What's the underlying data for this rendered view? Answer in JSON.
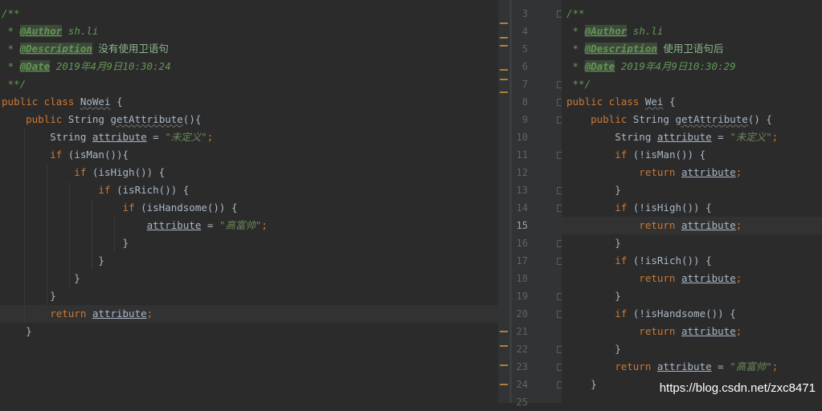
{
  "left": {
    "lines": [
      {
        "parts": [
          {
            "t": "/**",
            "c": "cm"
          }
        ]
      },
      {
        "parts": [
          {
            "t": " * ",
            "c": "cm"
          },
          {
            "t": "@Author",
            "c": "tag"
          },
          {
            "t": " sh.li",
            "c": "cm"
          }
        ]
      },
      {
        "parts": [
          {
            "t": " * ",
            "c": "cm"
          },
          {
            "t": "@Description",
            "c": "tag"
          },
          {
            "t": " 没有使用卫语句",
            "c": "cmt-zh"
          }
        ]
      },
      {
        "parts": [
          {
            "t": " * ",
            "c": "cm"
          },
          {
            "t": "@Date",
            "c": "tag"
          },
          {
            "t": " 2019年4月9日10:30:24",
            "c": "cm"
          }
        ]
      },
      {
        "parts": [
          {
            "t": " **/",
            "c": "cm"
          }
        ]
      },
      {
        "parts": [
          {
            "t": "public class ",
            "c": "kw"
          },
          {
            "t": "NoWei",
            "c": "fn"
          },
          {
            "t": " {",
            "c": ""
          }
        ]
      },
      {
        "parts": [
          {
            "t": "    public ",
            "c": "kw"
          },
          {
            "t": "String ",
            "c": ""
          },
          {
            "t": "getAttribute",
            "c": "fn"
          },
          {
            "t": "(){",
            "c": ""
          }
        ]
      },
      {
        "parts": [
          {
            "t": "        String ",
            "c": ""
          },
          {
            "t": "attribute",
            "c": "fld"
          },
          {
            "t": " = ",
            "c": ""
          },
          {
            "t": "\"未定义\"",
            "c": "str"
          },
          {
            "t": ";",
            "c": "kw"
          }
        ]
      },
      {
        "parts": [
          {
            "t": "        if ",
            "c": "kw"
          },
          {
            "t": "(isMan()){",
            "c": ""
          }
        ]
      },
      {
        "parts": [
          {
            "t": "            if ",
            "c": "kw"
          },
          {
            "t": "(isHigh()) {",
            "c": ""
          }
        ]
      },
      {
        "parts": [
          {
            "t": "                if ",
            "c": "kw"
          },
          {
            "t": "(isRich()) {",
            "c": ""
          }
        ]
      },
      {
        "parts": [
          {
            "t": "                    if ",
            "c": "kw"
          },
          {
            "t": "(isHandsome()) {",
            "c": ""
          }
        ]
      },
      {
        "parts": [
          {
            "t": "                        ",
            "c": ""
          },
          {
            "t": "attribute",
            "c": "fld"
          },
          {
            "t": " = ",
            "c": ""
          },
          {
            "t": "\"高富帅\"",
            "c": "str"
          },
          {
            "t": ";",
            "c": "kw"
          }
        ]
      },
      {
        "parts": [
          {
            "t": "                    }",
            "c": ""
          }
        ]
      },
      {
        "parts": [
          {
            "t": "                }",
            "c": ""
          }
        ]
      },
      {
        "parts": [
          {
            "t": "            }",
            "c": ""
          }
        ]
      },
      {
        "parts": [
          {
            "t": "        }",
            "c": ""
          }
        ]
      },
      {
        "hl": true,
        "parts": [
          {
            "t": "        return ",
            "c": "kw"
          },
          {
            "t": "attribute",
            "c": "fld"
          },
          {
            "t": ";",
            "c": "kw"
          }
        ]
      },
      {
        "parts": [
          {
            "t": "    }",
            "c": ""
          }
        ]
      }
    ]
  },
  "right": {
    "current_line": "15",
    "lines": [
      {
        "n": "3",
        "parts": [
          {
            "t": "/**",
            "c": "cm"
          }
        ]
      },
      {
        "n": "4",
        "parts": [
          {
            "t": " * ",
            "c": "cm"
          },
          {
            "t": "@Author",
            "c": "tag"
          },
          {
            "t": " sh.li",
            "c": "cm"
          }
        ]
      },
      {
        "n": "5",
        "parts": [
          {
            "t": " * ",
            "c": "cm"
          },
          {
            "t": "@Description",
            "c": "tag"
          },
          {
            "t": " 使用卫语句后",
            "c": "cmt-zh"
          }
        ]
      },
      {
        "n": "6",
        "parts": [
          {
            "t": " * ",
            "c": "cm"
          },
          {
            "t": "@Date",
            "c": "tag"
          },
          {
            "t": " 2019年4月9日10:30:29",
            "c": "cm"
          }
        ]
      },
      {
        "n": "7",
        "parts": [
          {
            "t": " **/",
            "c": "cm"
          }
        ]
      },
      {
        "n": "8",
        "parts": [
          {
            "t": "public class ",
            "c": "kw"
          },
          {
            "t": "Wei",
            "c": "fn"
          },
          {
            "t": " {",
            "c": ""
          }
        ]
      },
      {
        "n": "9",
        "parts": [
          {
            "t": "    public ",
            "c": "kw"
          },
          {
            "t": "String ",
            "c": ""
          },
          {
            "t": "getAttribute",
            "c": "fn"
          },
          {
            "t": "() {",
            "c": ""
          }
        ]
      },
      {
        "n": "10",
        "parts": [
          {
            "t": "        String ",
            "c": ""
          },
          {
            "t": "attribute",
            "c": "fld"
          },
          {
            "t": " = ",
            "c": ""
          },
          {
            "t": "\"未定义\"",
            "c": "str"
          },
          {
            "t": ";",
            "c": "kw"
          }
        ]
      },
      {
        "n": "11",
        "parts": [
          {
            "t": "        if ",
            "c": "kw"
          },
          {
            "t": "(!isMan()) {",
            "c": ""
          }
        ]
      },
      {
        "n": "12",
        "parts": [
          {
            "t": "            return ",
            "c": "kw"
          },
          {
            "t": "attribute",
            "c": "fld"
          },
          {
            "t": ";",
            "c": "kw"
          }
        ]
      },
      {
        "n": "13",
        "parts": [
          {
            "t": "        }",
            "c": ""
          }
        ]
      },
      {
        "n": "14",
        "parts": [
          {
            "t": "        if ",
            "c": "kw"
          },
          {
            "t": "(!isHigh()) {",
            "c": ""
          }
        ]
      },
      {
        "n": "15",
        "hl": true,
        "parts": [
          {
            "t": "            return ",
            "c": "kw"
          },
          {
            "t": "attribute",
            "c": "fld"
          },
          {
            "t": ";",
            "c": "kw"
          }
        ]
      },
      {
        "n": "16",
        "parts": [
          {
            "t": "        }",
            "c": ""
          }
        ]
      },
      {
        "n": "17",
        "parts": [
          {
            "t": "        if ",
            "c": "kw"
          },
          {
            "t": "(!isRich()) {",
            "c": ""
          }
        ]
      },
      {
        "n": "18",
        "parts": [
          {
            "t": "            return ",
            "c": "kw"
          },
          {
            "t": "attribute",
            "c": "fld"
          },
          {
            "t": ";",
            "c": "kw"
          }
        ]
      },
      {
        "n": "19",
        "parts": [
          {
            "t": "        }",
            "c": ""
          }
        ]
      },
      {
        "n": "20",
        "parts": [
          {
            "t": "        if ",
            "c": "kw"
          },
          {
            "t": "(!isHandsome()) {",
            "c": ""
          }
        ]
      },
      {
        "n": "21",
        "parts": [
          {
            "t": "            return ",
            "c": "kw"
          },
          {
            "t": "attribute",
            "c": "fld"
          },
          {
            "t": ";",
            "c": "kw"
          }
        ]
      },
      {
        "n": "22",
        "parts": [
          {
            "t": "        }",
            "c": ""
          }
        ]
      },
      {
        "n": "23",
        "parts": [
          {
            "t": "        return ",
            "c": "kw"
          },
          {
            "t": "attribute",
            "c": "fld"
          },
          {
            "t": " = ",
            "c": ""
          },
          {
            "t": "\"高富帅\"",
            "c": "str"
          },
          {
            "t": ";",
            "c": "kw"
          }
        ]
      },
      {
        "n": "24",
        "parts": [
          {
            "t": "    }",
            "c": ""
          }
        ]
      },
      {
        "n": "25",
        "parts": []
      }
    ]
  },
  "watermark": "https://blog.csdn.net/zxc8471",
  "colors": {
    "background": "#2b2b2b",
    "keyword": "#cc7832",
    "string": "#6a8759",
    "comment": "#629755"
  }
}
